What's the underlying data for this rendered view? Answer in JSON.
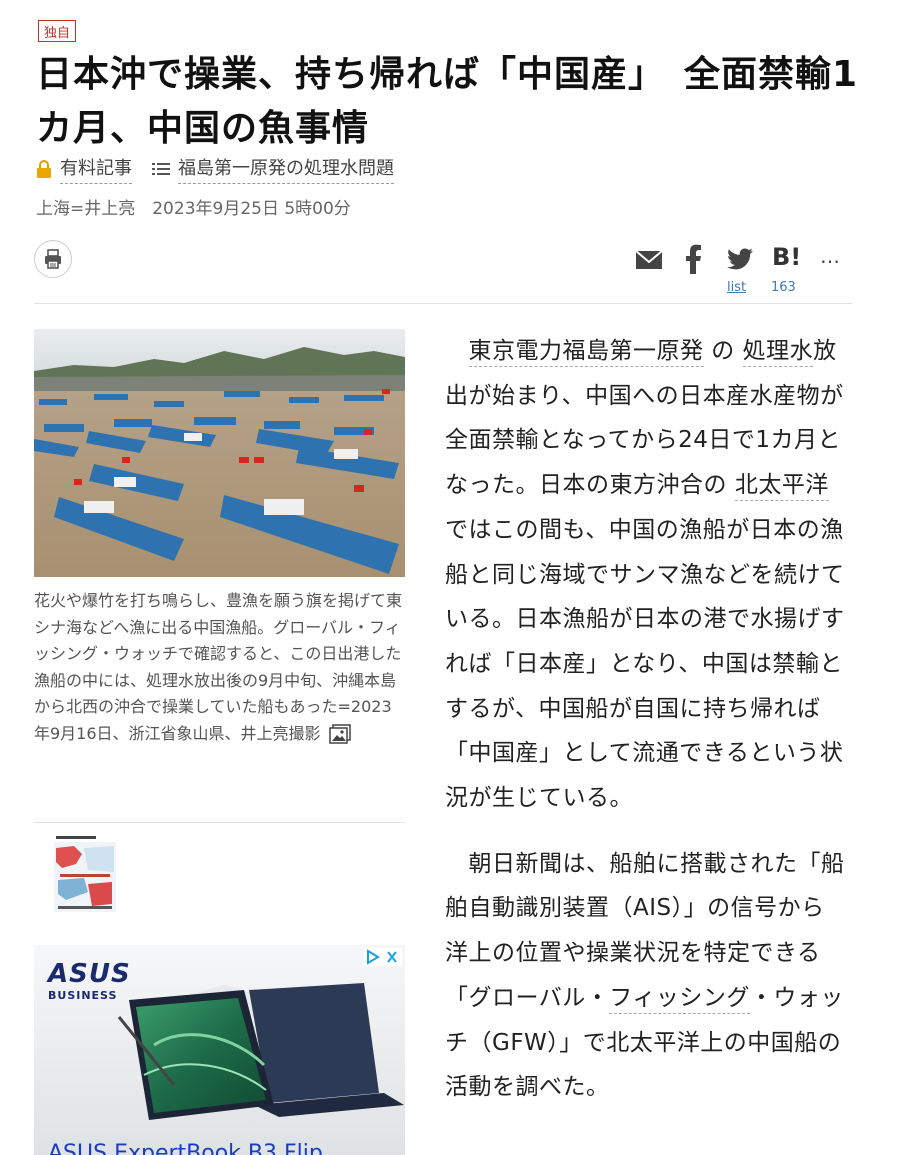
{
  "article": {
    "badge": "独自",
    "headline": "日本沖で操業、持ち帰れば「中国産」　全面禁輸1カ月、中国の魚事情",
    "paid_label": "有料記事",
    "series_label": "福島第一原発の処理水問題",
    "byline": "上海=井上亮　2023年9月25日 5時00分"
  },
  "share": {
    "hatebu_label": "B!",
    "more_label": "…",
    "list_link": "list",
    "bookmark_count": "163"
  },
  "photo": {
    "caption": "花火や爆竹を打ち鳴らし、豊漁を願う旗を掲げて東シナ海などへ漁に出る中国漁船。グローバル・フィッシング・ウォッチで確認すると、この日出港した漁船の中には、処理水放出後の9月中旬、沖縄本島から北西の沖合で操業していた船もあった=2023年9月16日、浙江省象山県、井上亮撮影"
  },
  "ad": {
    "brand": "ASUS",
    "sub": "BUSINESS",
    "bottom_text": "ASUS ExpertBook B3 Flip"
  },
  "body": {
    "p1": {
      "link1": "東京電力福島第一原発",
      "t1": " の ",
      "link2": "処理水",
      "t2": "放出が始まり、中国への日本産水産物が全面禁輸となってから24日で1カ月となった。日本の東方沖合の ",
      "link3": "北太平洋",
      "t3": " ではこの間も、中国の漁船が日本の漁船と同じ海域でサンマ漁などを続けている。日本漁船が日本の港で水揚げすれば「日本産」となり、中国は禁輸とするが、中国船が自国に持ち帰れば「中国産」として流通できるという状況が生じている。"
    },
    "p2": {
      "t1": "朝日新聞は、船舶に搭載された「船舶自動識別装置（AIS）」の信号から洋上の位置や操業状況を特定できる「グローバル・",
      "link1": "フィッシング",
      "t2": "・ウォッチ（GFW）」で北太平洋上の中国船の活動を調べた。"
    }
  }
}
